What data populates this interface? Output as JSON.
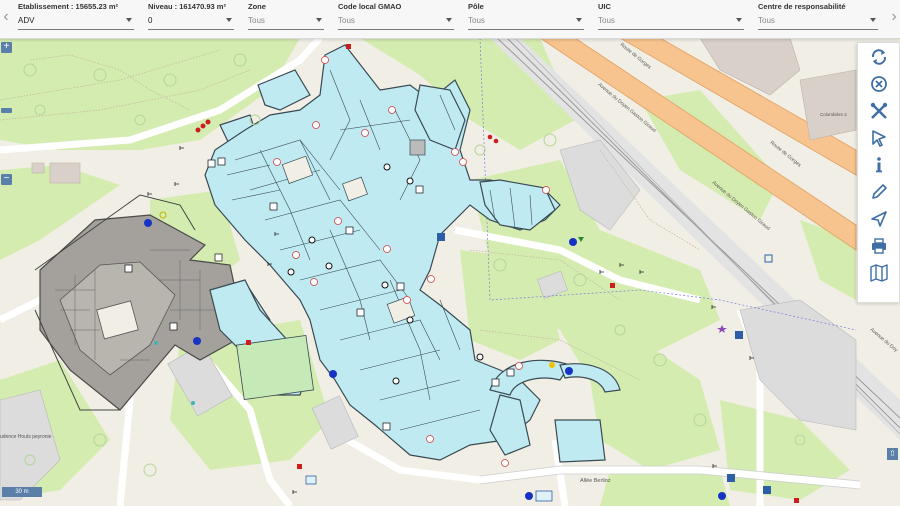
{
  "filters": [
    {
      "label": "Etablissement : 15655.23 m²",
      "value": "ADV"
    },
    {
      "label": "Niveau : 161470.93 m²",
      "value": "0"
    },
    {
      "label": "Zone",
      "value": "Tous"
    },
    {
      "label": "Code local GMAO",
      "value": "Tous"
    },
    {
      "label": "Pôle",
      "value": "Tous"
    },
    {
      "label": "UIC",
      "value": "Tous"
    },
    {
      "label": "Centre de responsabilité",
      "value": "Tous"
    }
  ],
  "nav": {
    "prev": "‹",
    "next": "›"
  },
  "map_controls": {
    "zoom_in": "+",
    "zoom_out": "−",
    "scale": "30 m",
    "scroll_top": "⇧"
  },
  "map_labels": {
    "route_gorges_1": "Route de Gorges",
    "route_gorges_2": "Route de Gorges",
    "avenue_doyen_1": "Avenue du Doyen Gaston Giraud",
    "avenue_doyen_2": "Avenue du Doyen Gaston Giraud",
    "allee_berlioz": "Allée Berlioz",
    "avenue_du_doy": "Avenue du Doy",
    "colombiere": "Colombière 2",
    "residence": "udence\nHouts\npeyronie"
  },
  "toolbar": [
    "refresh-icon",
    "close-circle-icon",
    "tools-icon",
    "pointer-icon",
    "info-icon",
    "pencil-icon",
    "navigate-icon",
    "print-icon",
    "map-icon"
  ],
  "colors": {
    "building": "#bfeaf2",
    "building_outline": "#3a4a52",
    "grass": "#d4ecb0",
    "road": "#f7c48f",
    "background": "#f1efe5",
    "icon": "#3f6fa4"
  }
}
